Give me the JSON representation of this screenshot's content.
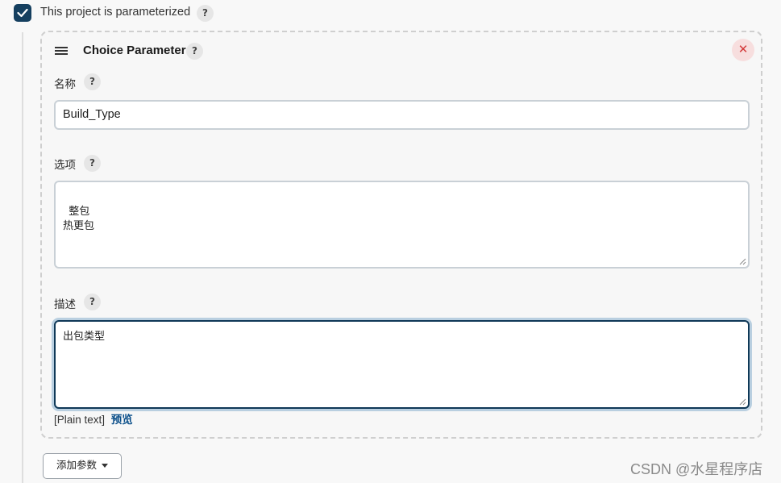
{
  "project": {
    "parameterized_label": "This project is parameterized",
    "parameterized_checked": true
  },
  "parameter": {
    "type_title": "Choice Parameter",
    "name_label": "名称",
    "name_value": "Build_Type",
    "choices_label": "选项",
    "choices_value": "整包\n热更包",
    "description_label": "描述",
    "description_value": "出包类型",
    "plain_text": "[Plain text]",
    "preview_link": "预览",
    "close_symbol": "✕"
  },
  "help_icon_text": "?",
  "add_param_button": "添加参数",
  "watermark": "CSDN @水星程序店",
  "colors": {
    "checkbox": "#153f5f",
    "focus_border": "#0f3857",
    "link": "#0b4f8a",
    "close": "#d33a3a"
  }
}
